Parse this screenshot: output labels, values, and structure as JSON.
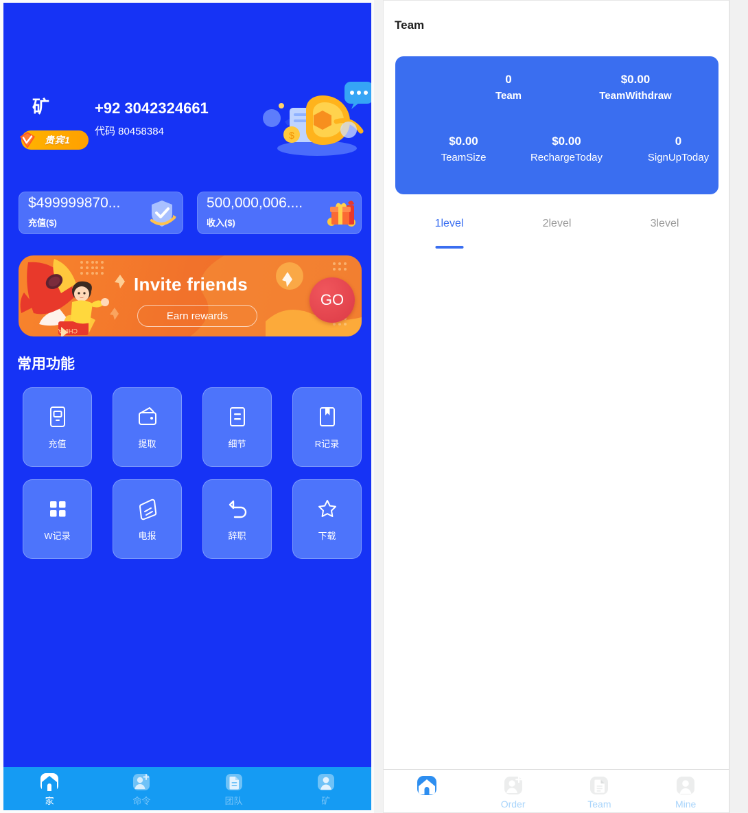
{
  "left_app": {
    "profile": {
      "display_name": "矿",
      "vip_badge": "贵宾1",
      "phone": "+92 3042324661",
      "code_label": "代码",
      "code_value": "80458384",
      "code_line": "代码 80458384"
    },
    "balances": [
      {
        "amount": "$499999870...",
        "label": "充值($)",
        "icon": "shield-check-icon"
      },
      {
        "amount": "500,000,006....",
        "label": "收入($)",
        "icon": "gift-box-icon"
      }
    ],
    "banner": {
      "title": "Invite friends",
      "subtitle": "Earn rewards",
      "cta": "GO"
    },
    "section_title": "常用功能",
    "features": [
      {
        "label": "充值",
        "icon": "recharge-icon"
      },
      {
        "label": "提取",
        "icon": "wallet-icon"
      },
      {
        "label": "细节",
        "icon": "document-lines-icon"
      },
      {
        "label": "R记录",
        "icon": "bookmark-icon"
      },
      {
        "label": "W记录",
        "icon": "grid-squares-icon"
      },
      {
        "label": "电报",
        "icon": "telegram-card-icon"
      },
      {
        "label": "辞职",
        "icon": "undo-arrow-icon"
      },
      {
        "label": "下载",
        "icon": "star-icon"
      }
    ],
    "bottom_nav": [
      {
        "label": "家",
        "icon": "home-icon",
        "active": true
      },
      {
        "label": "命令",
        "icon": "order-user-icon",
        "active": false
      },
      {
        "label": "团队",
        "icon": "team-doc-icon",
        "active": false
      },
      {
        "label": "矿",
        "icon": "mine-user-icon",
        "active": false
      }
    ]
  },
  "right_app": {
    "title": "Team",
    "stats": {
      "team": {
        "value": "0",
        "label": "Team"
      },
      "team_withdraw": {
        "value": "$0.00",
        "label": "TeamWithdraw"
      },
      "team_size": {
        "value": "$0.00",
        "label": "TeamSize"
      },
      "recharge_today": {
        "value": "$0.00",
        "label": "RechargeToday"
      },
      "signup_today": {
        "value": "0",
        "label": "SignUpToday"
      }
    },
    "level_tabs": [
      {
        "label": "1level",
        "active": true
      },
      {
        "label": "2level",
        "active": false
      },
      {
        "label": "3level",
        "active": false
      }
    ],
    "bottom_nav": [
      {
        "label": "",
        "icon": "home-icon",
        "active": true
      },
      {
        "label": "Order",
        "icon": "order-user-icon",
        "active": false
      },
      {
        "label": "Team",
        "icon": "team-doc-icon",
        "active": false
      },
      {
        "label": "Mine",
        "icon": "mine-user-icon",
        "active": false
      }
    ]
  },
  "colors": {
    "left_bg": "#1633f5",
    "card_blue": "#4d70fb",
    "left_nav": "#159bf3",
    "accent_blue": "#3a6ef0",
    "banner_orange": "#f1722b",
    "vip_gold": "#ffa000"
  }
}
